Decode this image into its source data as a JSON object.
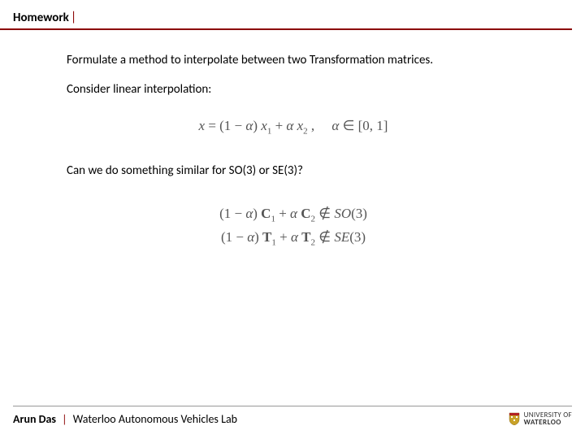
{
  "header": {
    "title": "Homework",
    "pipe": "|"
  },
  "content": {
    "p1": "Formulate a method to interpolate between two Transformation matrices.",
    "p2": "Consider linear interpolation:",
    "formula1": "x = (1 − α) x₁ + α x₂ ,     α ∈ [0, 1]",
    "p3": "Can we do something similar for SO(3) or SE(3)?",
    "formula2a": "(1 − α) C₁ + α C₂ ∉ SO(3)",
    "formula2b": "(1 − α) T₁ + α T₂ ∉ SE(3)"
  },
  "footer": {
    "author": "Arun Das",
    "pipe": "|",
    "lab": "Waterloo Autonomous Vehicles Lab",
    "logo_top": "UNIVERSITY OF",
    "logo_bottom": "WATERLOO"
  }
}
